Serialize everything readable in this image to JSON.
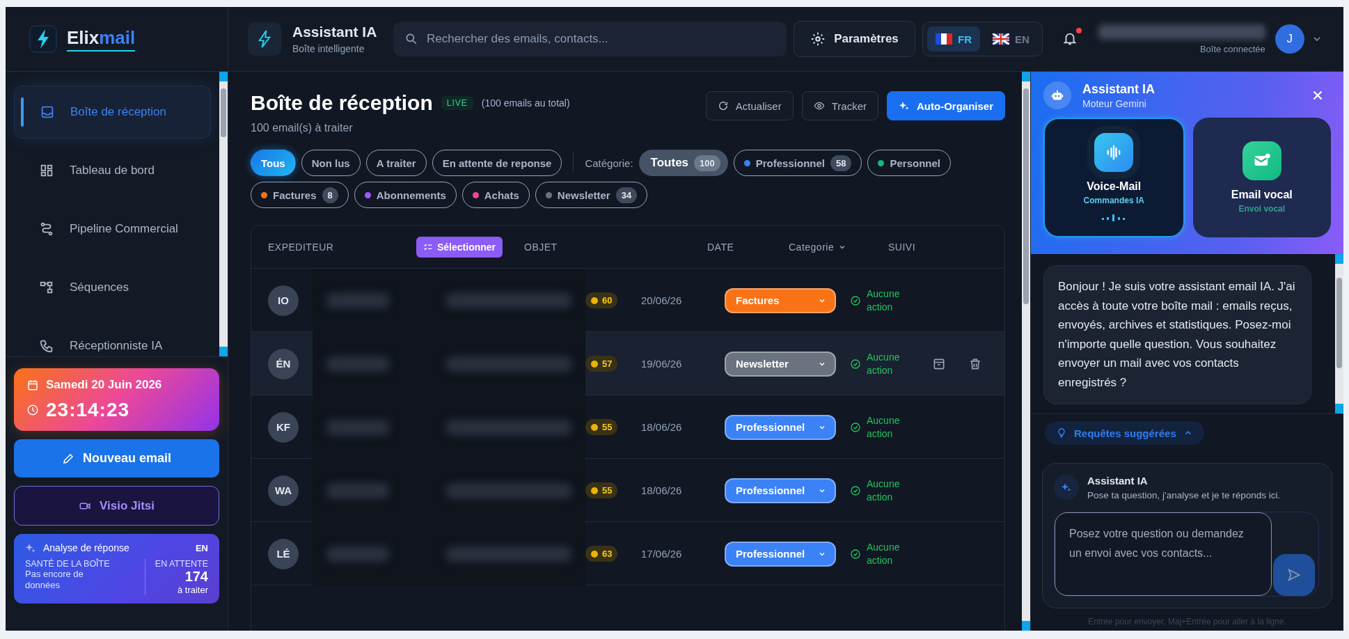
{
  "sidebar": {
    "logo": [
      "Elix",
      "mail"
    ],
    "nav": [
      {
        "label": "Boîte de réception",
        "selected": true
      },
      {
        "label": "Tableau de bord",
        "selected": false
      },
      {
        "label": "Pipeline Commercial",
        "selected": false
      },
      {
        "label": "Séquences",
        "selected": false
      },
      {
        "label": "Réceptionniste IA",
        "selected": false
      }
    ],
    "date": "Samedi 20 Juin 2026",
    "time": "23:14:23",
    "new_email": "Nouveau email",
    "visio": "Visio Jitsi",
    "analysis": {
      "title": "Analyse de réponse",
      "lang": "EN",
      "health_label": "SANTÉ DE LA BOÎTE",
      "health_value": "Pas encore de données",
      "pending_label": "EN ATTENTE",
      "pending_count": "174",
      "pending_sub": "à traiter"
    }
  },
  "header": {
    "title": "Assistant IA",
    "subtitle": "Boîte intelligente",
    "search": {
      "placeholder": "Rechercher des emails, contacts..."
    },
    "settings": "Paramètres",
    "languages": [
      {
        "code": "FR",
        "selected": true
      },
      {
        "code": "EN",
        "selected": false
      }
    ],
    "notifications": {
      "unread": true
    },
    "account": {
      "status": "Boîte connectée",
      "avatar": "J"
    }
  },
  "inbox": {
    "title": "Boîte de réception",
    "live": "LIVE",
    "total": "(100 emails au total)",
    "subtitle": "100 email(s) à traiter",
    "actions": [
      {
        "label": "Actualiser",
        "kind": "refresh"
      },
      {
        "label": "Tracker",
        "kind": "tracker"
      },
      {
        "label": "Auto-Organiser",
        "kind": "primary"
      }
    ],
    "status_filters": [
      {
        "label": "Tous",
        "selected": true
      },
      {
        "label": "Non lus",
        "selected": false
      },
      {
        "label": "A traiter",
        "selected": false
      },
      {
        "label": "En attente de reponse",
        "selected": false
      }
    ],
    "category_label": "Catégorie:",
    "category_filters": [
      {
        "label": "Toutes",
        "count": "100",
        "selected": true
      },
      {
        "label": "Professionnel",
        "count": "58",
        "color": "#3b82f6",
        "selected": false
      },
      {
        "label": "Personnel",
        "color": "#10b981",
        "selected": false
      },
      {
        "label": "Factures",
        "count": "8",
        "color": "#f97316",
        "selected": false
      },
      {
        "label": "Abonnements",
        "color": "#a855f7",
        "selected": false
      },
      {
        "label": "Achats",
        "color": "#ec4899",
        "selected": false
      },
      {
        "label": "Newsletter",
        "count": "34",
        "color": "#6b7280",
        "selected": false
      }
    ],
    "table": {
      "columns": {
        "sender": "EXPEDITEUR",
        "select": "Sélectionner",
        "subject": "OBJET",
        "date": "DATE",
        "category": "Categorie",
        "followup": "SUIVI"
      },
      "rows": [
        {
          "initials": "IO",
          "score": "60",
          "date": "20/06/26",
          "category": "Factures",
          "color": "#f97316",
          "followup": "Aucune action",
          "hovered": false
        },
        {
          "initials": "ÉN",
          "score": "57",
          "date": "19/06/26",
          "category": "Newsletter",
          "color": "#6b7280",
          "followup": "Aucune action",
          "hovered": true
        },
        {
          "initials": "KF",
          "score": "55",
          "date": "18/06/26",
          "category": "Professionnel",
          "color": "#3b82f6",
          "followup": "Aucune action",
          "hovered": false
        },
        {
          "initials": "WA",
          "score": "55",
          "date": "18/06/26",
          "category": "Professionnel",
          "color": "#3b82f6",
          "followup": "Aucune action",
          "hovered": false
        },
        {
          "initials": "LÉ",
          "score": "63",
          "date": "17/06/26",
          "category": "Professionnel",
          "color": "#3b82f6",
          "followup": "Aucune action",
          "hovered": false
        }
      ]
    }
  },
  "assistant": {
    "title": "Assistant IA",
    "subtitle": "Moteur Gemini",
    "modes": [
      {
        "title": "Voice-Mail",
        "subtitle": "Commandes IA",
        "selected": true
      },
      {
        "title": "Email vocal",
        "subtitle": "Envoi vocal",
        "selected": false
      }
    ],
    "message": "Bonjour ! Je suis votre assistant email IA. J'ai accès à toute votre boîte mail : emails reçus, envoyés, archives et statistiques. Posez-moi n'importe quelle question. Vous souhaitez envoyer un mail avec vos contacts enregistrés ?",
    "suggestions": {
      "label": "Requêtes suggérées",
      "expanded": true
    },
    "composer": {
      "title": "Assistant IA",
      "subtitle": "Pose ta question, j'analyse et je te réponds ici.",
      "placeholder": "Posez votre question ou demandez un envoi avec vos contacts...",
      "hint": "Entrée pour envoyer, Maj+Entrée pour aller à la ligne."
    }
  }
}
